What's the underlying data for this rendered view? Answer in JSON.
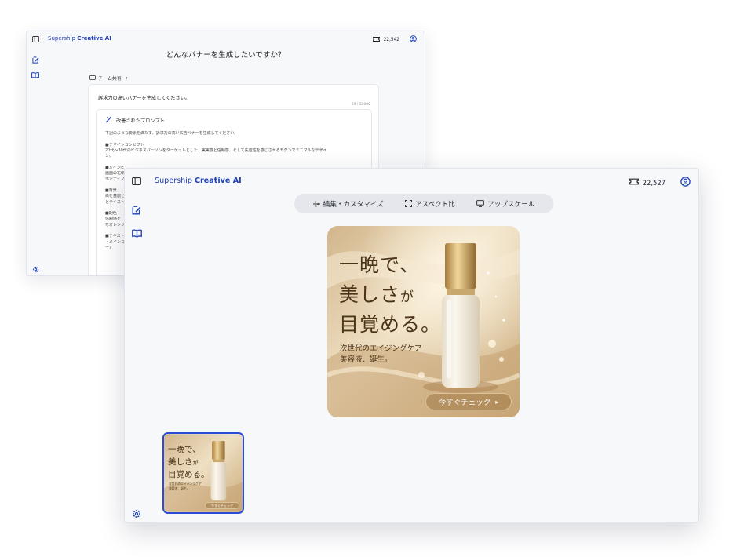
{
  "back_window": {
    "brand_prefix": "Supership",
    "brand_suffix": "Creative AI",
    "credits": "22,542",
    "title": "どんなバナーを生成したいですか？",
    "team_label": "チーム共有",
    "prompt": "訴求力の高いバナーを生成してください。",
    "char_count": "19 / 10000",
    "improved_label": "改善されたプロンプト",
    "improved_lines": [
      "下記のような要素を満たす、訴求力の高い広告バナーを生成してください。",
      "",
      "■デザインコンセプト",
      "20代〜30代のビジネスパーソンをターゲットとした、実実感と信頼感、そして先進性を感じさせるモダンでミニマルなデザイ",
      "ン。",
      "",
      "■メインビ",
      "画面の右側",
      "ポジティブ",
      "",
      "■背景",
      "白を基調と",
      "とテキスト",
      "",
      "■配色",
      "信頼感を",
      "なオレンジ",
      "",
      "■テキスト",
      "・メインコ",
      "ー」"
    ]
  },
  "front_window": {
    "brand_prefix": "Supership",
    "brand_suffix": "Creative AI",
    "credits": "22,527",
    "toolbar": {
      "edit": "編集・カスタマイズ",
      "aspect": "アスペクト比",
      "upscale": "アップスケール"
    },
    "banner": {
      "headline_1": "一晩で、",
      "headline_2a": "美しさ",
      "headline_2b": "が",
      "headline_3": "目覚める。",
      "sub_1": "次世代のエイジングケア",
      "sub_2": "美容液、誕生。",
      "cta": "今すぐチェック"
    }
  },
  "colors": {
    "brand": "#1d3fb8",
    "selected_border": "#2a4bd7",
    "banner_gold": "#d8c09a"
  },
  "icons": [
    "sidebar-toggle-icon",
    "edit-icon",
    "book-icon",
    "settings-icon",
    "ticket-icon",
    "user-icon",
    "sliders-icon",
    "aspect-icon",
    "upscale-icon"
  ]
}
